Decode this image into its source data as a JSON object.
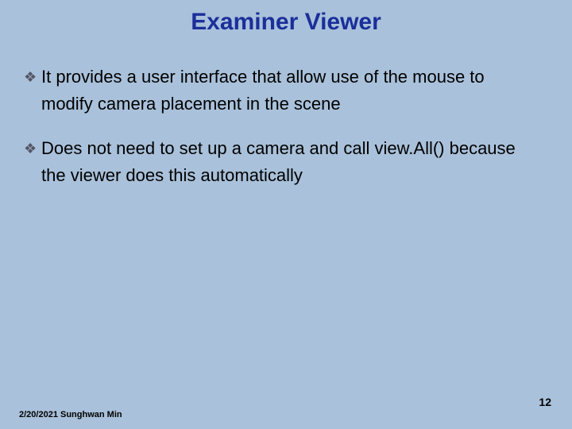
{
  "title": "Examiner Viewer",
  "bullets": [
    "It provides a user interface that allow use of the mouse to modify camera placement in the scene",
    "Does not need to set up a camera and call view.All() because the viewer does this automatically"
  ],
  "footer": {
    "date": "2/20/2021",
    "author": "Sunghwan Min"
  },
  "page_number": "12"
}
